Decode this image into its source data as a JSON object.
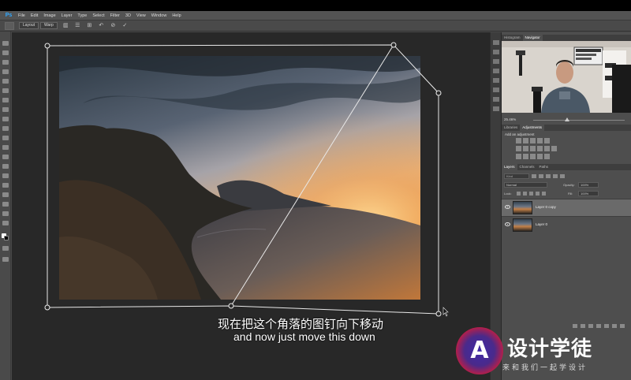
{
  "app": {
    "logo": "Ps"
  },
  "menu": [
    "File",
    "Edit",
    "Image",
    "Layer",
    "Type",
    "Select",
    "Filter",
    "3D",
    "View",
    "Window",
    "Help"
  ],
  "options": {
    "layout_label": "Layout",
    "warp_label": "Warp"
  },
  "panels": {
    "top_tabs": [
      "Histogram",
      "Navigator"
    ],
    "zoom": "25.46%",
    "adj_tabs": [
      "Libraries",
      "Adjustments"
    ],
    "adj_title": "Add an adjustment",
    "layer_tabs": [
      "Layers",
      "Channels",
      "Paths"
    ],
    "filter_kind": "Kind",
    "blend_mode": "Normal",
    "opacity_label": "Opacity:",
    "opacity_value": "100%",
    "lock_label": "Lock:",
    "fill_label": "Fill:",
    "fill_value": "100%",
    "layers": [
      {
        "name": "Layer 0 copy",
        "selected": true
      },
      {
        "name": "Layer 0",
        "selected": false
      }
    ]
  },
  "subtitles": {
    "chinese": "现在把这个角落的图钉向下移动",
    "english": "and now just move this down"
  },
  "watermark": {
    "logo_letter": "A",
    "title": "设计学徒",
    "subtitle": "来和我们一起学设计"
  },
  "colors": {
    "accent_blue": "#31a8ff",
    "canvas_bg": "#282828",
    "ui_gray": "#474747"
  }
}
